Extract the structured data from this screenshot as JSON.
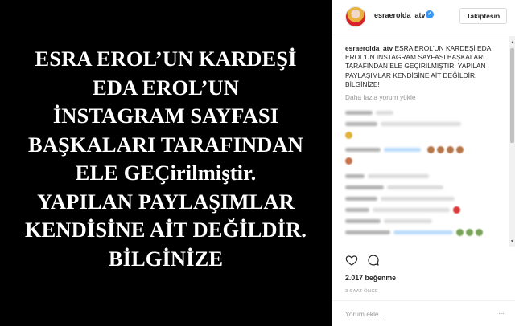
{
  "post_image": {
    "lines": [
      "ESRA EROL’UN KARDEŞİ",
      "EDA EROL’UN",
      "İNSTAGRAM SAYFASI",
      "BAŞKALARI TARAFINDAN",
      "ELE GEÇirilmiştir.",
      "YAPILAN PAYLAŞIMLAR",
      "KENDİSİNE AİT DEĞİLDİR.",
      "BİLGİNİZE"
    ]
  },
  "header": {
    "username": "esraerolda_atv",
    "verified_icon": "verified-badge-icon",
    "follow_label": "Takiptesin"
  },
  "caption": {
    "username": "esraerolda_atv",
    "text": "ESRA EROL'UN KARDEŞİ EDA EROL'UN INSTAGRAM SAYFASI BAŞKALARI TARAFINDAN ELE GEÇİRİLMİŞTİR. YAPILAN PAYLAŞIMLAR KENDİSİNE AİT DEĞİLDİR. BİLGİNİZE!"
  },
  "load_more": "Daha fazla yorum yükle",
  "likes": "2.017 beğenme",
  "timestamp": "3 SAAT ÖNCE",
  "comment_input": {
    "placeholder": "Yorum ekle..."
  },
  "colors": {
    "image_bg": "#000000",
    "image_text": "#ffffff",
    "link_blue": "#3897f0",
    "muted": "#999999"
  }
}
